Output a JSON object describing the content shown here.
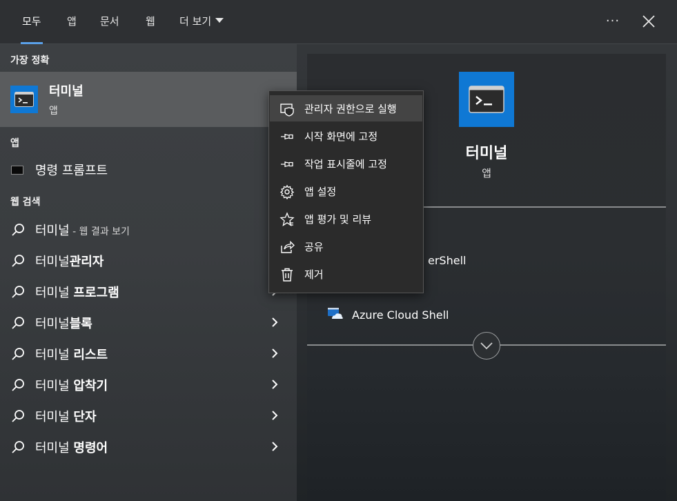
{
  "tabs": [
    {
      "label": "모두",
      "active": true
    },
    {
      "label": "앱",
      "active": false
    },
    {
      "label": "문서",
      "active": false
    },
    {
      "label": "웹",
      "active": false
    },
    {
      "label": "더 보기",
      "active": false
    }
  ],
  "top_actions": {
    "more": "···"
  },
  "best_match": {
    "header": "가장 정확",
    "title": "터미널",
    "subtitle": "앱"
  },
  "apps_section": {
    "header": "앱",
    "items": [
      {
        "label": "명령 프롬프트",
        "icon": "command-prompt-icon"
      }
    ]
  },
  "web_section": {
    "header": "웹 검색",
    "items": [
      {
        "prefix": "터미널",
        "bold": "",
        "suffix": " - 웹 결과 보기",
        "chevron": false
      },
      {
        "prefix": "터미널",
        "bold": "관리자",
        "suffix": "",
        "chevron": true
      },
      {
        "prefix": "터미널 ",
        "bold": "프로그램",
        "suffix": "",
        "chevron": true
      },
      {
        "prefix": "터미널",
        "bold": "블록",
        "suffix": "",
        "chevron": true
      },
      {
        "prefix": "터미널 ",
        "bold": "리스트",
        "suffix": "",
        "chevron": true
      },
      {
        "prefix": "터미널 ",
        "bold": "압착기",
        "suffix": "",
        "chevron": true
      },
      {
        "prefix": "터미널 ",
        "bold": "단자",
        "suffix": "",
        "chevron": true
      },
      {
        "prefix": "터미널 ",
        "bold": "명령어",
        "suffix": "",
        "chevron": true
      }
    ]
  },
  "context_menu": {
    "items": [
      {
        "label": "관리자 권한으로 실행",
        "icon": "shield-icon"
      },
      {
        "label": "시작 화면에 고정",
        "icon": "pin-icon"
      },
      {
        "label": "작업 표시줄에 고정",
        "icon": "pin-icon"
      },
      {
        "label": "앱 설정",
        "icon": "gear-icon"
      },
      {
        "label": "앱 평가 및 리뷰",
        "icon": "star-icon"
      },
      {
        "label": "공유",
        "icon": "share-icon"
      },
      {
        "label": "제거",
        "icon": "trash-icon"
      }
    ]
  },
  "preview": {
    "title": "터미널",
    "subtitle": "앱",
    "actions": [
      {
        "label": "erShell"
      },
      {
        "label": "Azure Cloud Shell",
        "icon": "azure-cloud-shell-icon"
      }
    ]
  },
  "colors": {
    "accent": "#0f78d4",
    "tab_underline": "#5aa0e8"
  }
}
